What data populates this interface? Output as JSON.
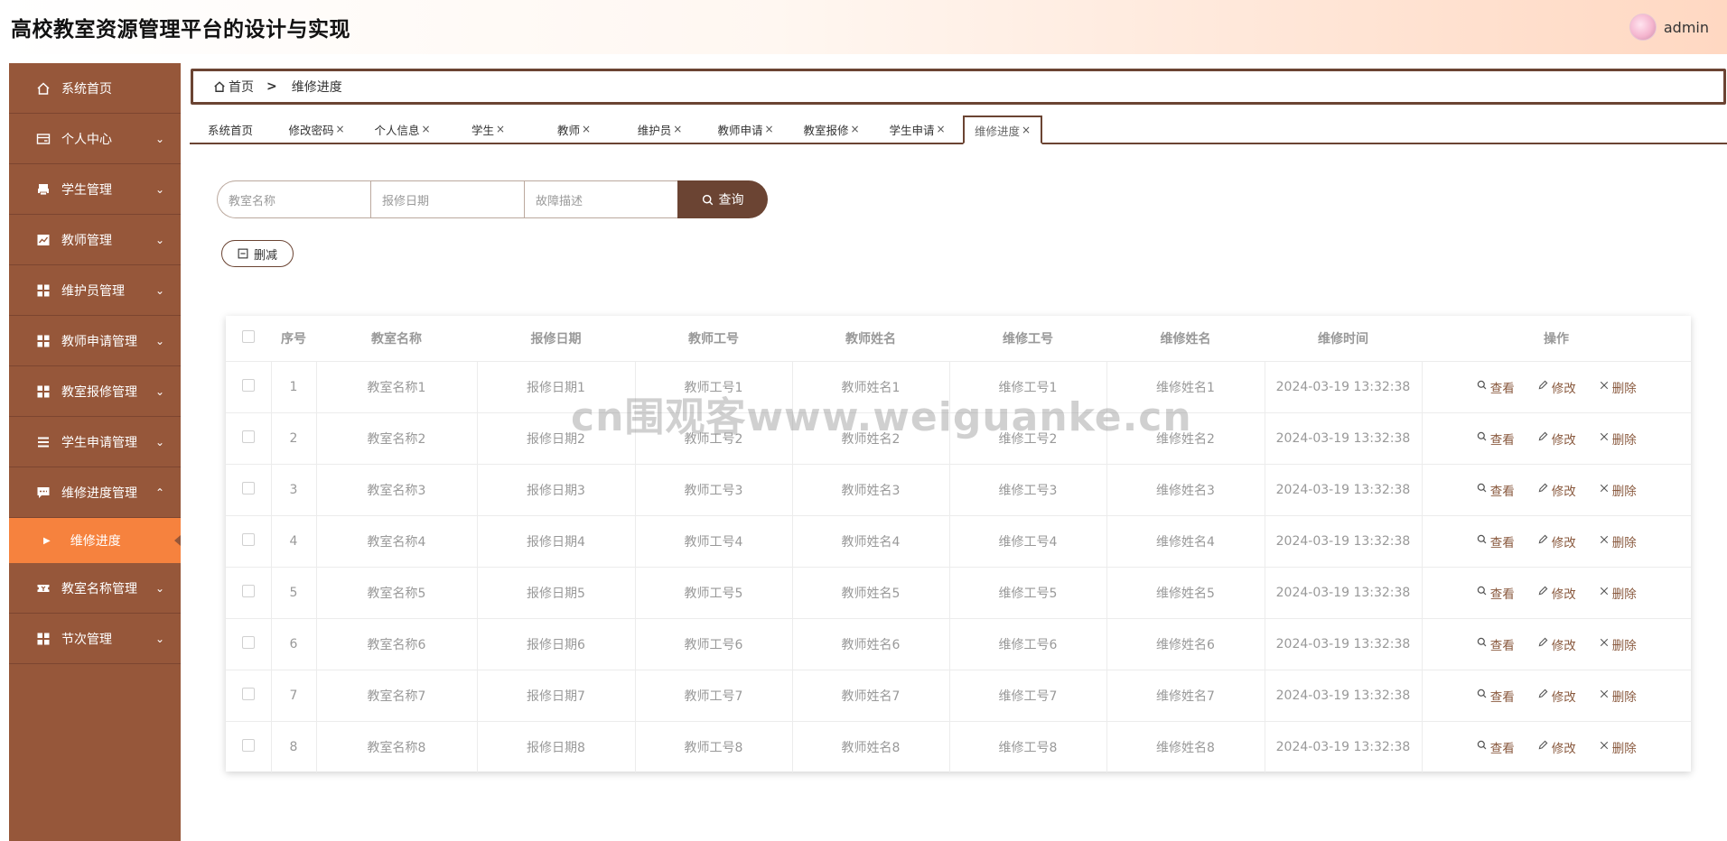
{
  "header": {
    "title": "高校教室资源管理平台的设计与实现",
    "username": "admin"
  },
  "sidebar": {
    "items": [
      {
        "label": "系统首页",
        "icon": "home-icon",
        "arrow": ""
      },
      {
        "label": "个人中心",
        "icon": "id-card-icon",
        "arrow": "⌄"
      },
      {
        "label": "学生管理",
        "icon": "printer-icon",
        "arrow": "⌄"
      },
      {
        "label": "教师管理",
        "icon": "chart-icon",
        "arrow": "⌄"
      },
      {
        "label": "维护员管理",
        "icon": "grid-icon",
        "arrow": "⌄"
      },
      {
        "label": "教师申请管理",
        "icon": "grid-icon",
        "arrow": "⌄"
      },
      {
        "label": "教室报修管理",
        "icon": "grid-icon",
        "arrow": "⌄"
      },
      {
        "label": "学生申请管理",
        "icon": "list-icon",
        "arrow": "⌄"
      },
      {
        "label": "维修进度管理",
        "icon": "message-icon",
        "arrow": "⌃"
      },
      {
        "label": "教室名称管理",
        "icon": "ticket-icon",
        "arrow": "⌄"
      },
      {
        "label": "节次管理",
        "icon": "grid-icon",
        "arrow": "⌄"
      }
    ],
    "sub_item": "维修进度"
  },
  "breadcrumb": {
    "home": "首页",
    "sep": ">",
    "current": "维修进度"
  },
  "tabs": [
    {
      "label": "系统首页",
      "close": ""
    },
    {
      "label": "修改密码",
      "close": "×"
    },
    {
      "label": "个人信息",
      "close": "×"
    },
    {
      "label": "学生",
      "close": "×"
    },
    {
      "label": "教师",
      "close": "×"
    },
    {
      "label": "维护员",
      "close": "×"
    },
    {
      "label": "教师申请",
      "close": "×"
    },
    {
      "label": "教室报修",
      "close": "×"
    },
    {
      "label": "学生申请",
      "close": "×"
    },
    {
      "label": "维修进度",
      "close": "×"
    }
  ],
  "search": {
    "room_placeholder": "教室名称",
    "date_placeholder": "报修日期",
    "fault_placeholder": "故障描述",
    "button": "查询"
  },
  "actions": {
    "delete": "删减"
  },
  "table": {
    "headers": [
      "序号",
      "教室名称",
      "报修日期",
      "教师工号",
      "教师姓名",
      "维修工号",
      "维修姓名",
      "维修时间",
      "操作"
    ],
    "ops": {
      "view": "查看",
      "edit": "修改",
      "delete": "删除"
    },
    "rows": [
      [
        "1",
        "教室名称1",
        "报修日期1",
        "教师工号1",
        "教师姓名1",
        "维修工号1",
        "维修姓名1",
        "2024-03-19 13:32:38"
      ],
      [
        "2",
        "教室名称2",
        "报修日期2",
        "教师工号2",
        "教师姓名2",
        "维修工号2",
        "维修姓名2",
        "2024-03-19 13:32:38"
      ],
      [
        "3",
        "教室名称3",
        "报修日期3",
        "教师工号3",
        "教师姓名3",
        "维修工号3",
        "维修姓名3",
        "2024-03-19 13:32:38"
      ],
      [
        "4",
        "教室名称4",
        "报修日期4",
        "教师工号4",
        "教师姓名4",
        "维修工号4",
        "维修姓名4",
        "2024-03-19 13:32:38"
      ],
      [
        "5",
        "教室名称5",
        "报修日期5",
        "教师工号5",
        "教师姓名5",
        "维修工号5",
        "维修姓名5",
        "2024-03-19 13:32:38"
      ],
      [
        "6",
        "教室名称6",
        "报修日期6",
        "教师工号6",
        "教师姓名6",
        "维修工号6",
        "维修姓名6",
        "2024-03-19 13:32:38"
      ],
      [
        "7",
        "教室名称7",
        "报修日期7",
        "教师工号7",
        "教师姓名7",
        "维修工号7",
        "维修姓名7",
        "2024-03-19 13:32:38"
      ],
      [
        "8",
        "教室名称8",
        "报修日期8",
        "教师工号8",
        "教师姓名8",
        "维修工号8",
        "维修姓名8",
        "2024-03-19 13:32:38"
      ]
    ]
  },
  "watermark": "cn围观客www.weiguanke.cn"
}
